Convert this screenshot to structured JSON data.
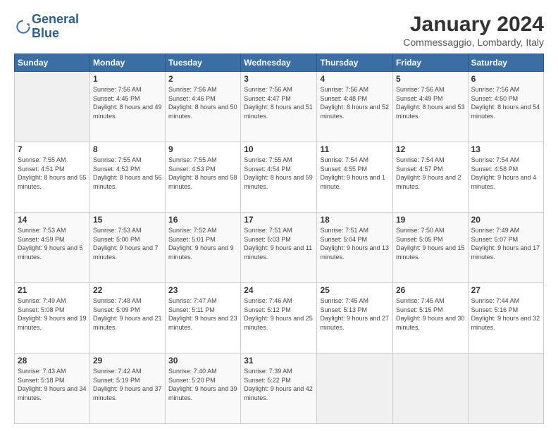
{
  "header": {
    "logo_line1": "General",
    "logo_line2": "Blue",
    "month_title": "January 2024",
    "location": "Commessaggio, Lombardy, Italy"
  },
  "weekdays": [
    "Sunday",
    "Monday",
    "Tuesday",
    "Wednesday",
    "Thursday",
    "Friday",
    "Saturday"
  ],
  "weeks": [
    [
      {
        "day": "",
        "sunrise": "",
        "sunset": "",
        "daylight": ""
      },
      {
        "day": "1",
        "sunrise": "Sunrise: 7:56 AM",
        "sunset": "Sunset: 4:45 PM",
        "daylight": "Daylight: 8 hours and 49 minutes."
      },
      {
        "day": "2",
        "sunrise": "Sunrise: 7:56 AM",
        "sunset": "Sunset: 4:46 PM",
        "daylight": "Daylight: 8 hours and 50 minutes."
      },
      {
        "day": "3",
        "sunrise": "Sunrise: 7:56 AM",
        "sunset": "Sunset: 4:47 PM",
        "daylight": "Daylight: 8 hours and 51 minutes."
      },
      {
        "day": "4",
        "sunrise": "Sunrise: 7:56 AM",
        "sunset": "Sunset: 4:48 PM",
        "daylight": "Daylight: 8 hours and 52 minutes."
      },
      {
        "day": "5",
        "sunrise": "Sunrise: 7:56 AM",
        "sunset": "Sunset: 4:49 PM",
        "daylight": "Daylight: 8 hours and 53 minutes."
      },
      {
        "day": "6",
        "sunrise": "Sunrise: 7:56 AM",
        "sunset": "Sunset: 4:50 PM",
        "daylight": "Daylight: 8 hours and 54 minutes."
      }
    ],
    [
      {
        "day": "7",
        "sunrise": "Sunrise: 7:55 AM",
        "sunset": "Sunset: 4:51 PM",
        "daylight": "Daylight: 8 hours and 55 minutes."
      },
      {
        "day": "8",
        "sunrise": "Sunrise: 7:55 AM",
        "sunset": "Sunset: 4:52 PM",
        "daylight": "Daylight: 8 hours and 56 minutes."
      },
      {
        "day": "9",
        "sunrise": "Sunrise: 7:55 AM",
        "sunset": "Sunset: 4:53 PM",
        "daylight": "Daylight: 8 hours and 58 minutes."
      },
      {
        "day": "10",
        "sunrise": "Sunrise: 7:55 AM",
        "sunset": "Sunset: 4:54 PM",
        "daylight": "Daylight: 8 hours and 59 minutes."
      },
      {
        "day": "11",
        "sunrise": "Sunrise: 7:54 AM",
        "sunset": "Sunset: 4:55 PM",
        "daylight": "Daylight: 9 hours and 1 minute."
      },
      {
        "day": "12",
        "sunrise": "Sunrise: 7:54 AM",
        "sunset": "Sunset: 4:57 PM",
        "daylight": "Daylight: 9 hours and 2 minutes."
      },
      {
        "day": "13",
        "sunrise": "Sunrise: 7:54 AM",
        "sunset": "Sunset: 4:58 PM",
        "daylight": "Daylight: 9 hours and 4 minutes."
      }
    ],
    [
      {
        "day": "14",
        "sunrise": "Sunrise: 7:53 AM",
        "sunset": "Sunset: 4:59 PM",
        "daylight": "Daylight: 9 hours and 5 minutes."
      },
      {
        "day": "15",
        "sunrise": "Sunrise: 7:53 AM",
        "sunset": "Sunset: 5:00 PM",
        "daylight": "Daylight: 9 hours and 7 minutes."
      },
      {
        "day": "16",
        "sunrise": "Sunrise: 7:52 AM",
        "sunset": "Sunset: 5:01 PM",
        "daylight": "Daylight: 9 hours and 9 minutes."
      },
      {
        "day": "17",
        "sunrise": "Sunrise: 7:51 AM",
        "sunset": "Sunset: 5:03 PM",
        "daylight": "Daylight: 9 hours and 11 minutes."
      },
      {
        "day": "18",
        "sunrise": "Sunrise: 7:51 AM",
        "sunset": "Sunset: 5:04 PM",
        "daylight": "Daylight: 9 hours and 13 minutes."
      },
      {
        "day": "19",
        "sunrise": "Sunrise: 7:50 AM",
        "sunset": "Sunset: 5:05 PM",
        "daylight": "Daylight: 9 hours and 15 minutes."
      },
      {
        "day": "20",
        "sunrise": "Sunrise: 7:49 AM",
        "sunset": "Sunset: 5:07 PM",
        "daylight": "Daylight: 9 hours and 17 minutes."
      }
    ],
    [
      {
        "day": "21",
        "sunrise": "Sunrise: 7:49 AM",
        "sunset": "Sunset: 5:08 PM",
        "daylight": "Daylight: 9 hours and 19 minutes."
      },
      {
        "day": "22",
        "sunrise": "Sunrise: 7:48 AM",
        "sunset": "Sunset: 5:09 PM",
        "daylight": "Daylight: 9 hours and 21 minutes."
      },
      {
        "day": "23",
        "sunrise": "Sunrise: 7:47 AM",
        "sunset": "Sunset: 5:11 PM",
        "daylight": "Daylight: 9 hours and 23 minutes."
      },
      {
        "day": "24",
        "sunrise": "Sunrise: 7:46 AM",
        "sunset": "Sunset: 5:12 PM",
        "daylight": "Daylight: 9 hours and 25 minutes."
      },
      {
        "day": "25",
        "sunrise": "Sunrise: 7:45 AM",
        "sunset": "Sunset: 5:13 PM",
        "daylight": "Daylight: 9 hours and 27 minutes."
      },
      {
        "day": "26",
        "sunrise": "Sunrise: 7:45 AM",
        "sunset": "Sunset: 5:15 PM",
        "daylight": "Daylight: 9 hours and 30 minutes."
      },
      {
        "day": "27",
        "sunrise": "Sunrise: 7:44 AM",
        "sunset": "Sunset: 5:16 PM",
        "daylight": "Daylight: 9 hours and 32 minutes."
      }
    ],
    [
      {
        "day": "28",
        "sunrise": "Sunrise: 7:43 AM",
        "sunset": "Sunset: 5:18 PM",
        "daylight": "Daylight: 9 hours and 34 minutes."
      },
      {
        "day": "29",
        "sunrise": "Sunrise: 7:42 AM",
        "sunset": "Sunset: 5:19 PM",
        "daylight": "Daylight: 9 hours and 37 minutes."
      },
      {
        "day": "30",
        "sunrise": "Sunrise: 7:40 AM",
        "sunset": "Sunset: 5:20 PM",
        "daylight": "Daylight: 9 hours and 39 minutes."
      },
      {
        "day": "31",
        "sunrise": "Sunrise: 7:39 AM",
        "sunset": "Sunset: 5:22 PM",
        "daylight": "Daylight: 9 hours and 42 minutes."
      },
      {
        "day": "",
        "sunrise": "",
        "sunset": "",
        "daylight": ""
      },
      {
        "day": "",
        "sunrise": "",
        "sunset": "",
        "daylight": ""
      },
      {
        "day": "",
        "sunrise": "",
        "sunset": "",
        "daylight": ""
      }
    ]
  ]
}
